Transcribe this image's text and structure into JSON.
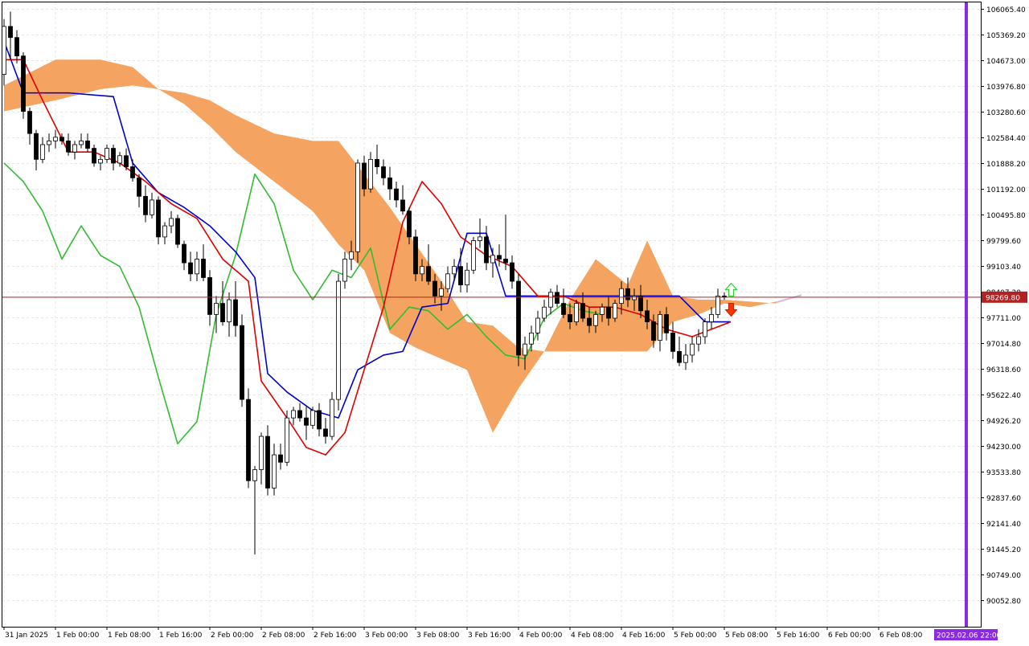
{
  "chart_data": {
    "type": "candlestick",
    "symbol_hint": "",
    "y_axis": {
      "ticks": [
        106065.4,
        105369.2,
        104673.0,
        103976.8,
        103280.6,
        102584.4,
        101888.2,
        101192.0,
        100495.8,
        99799.6,
        99103.4,
        98407.2,
        97711.0,
        97014.8,
        96318.6,
        95622.4,
        94926.2,
        94230.0,
        93533.8,
        92837.6,
        92141.4,
        91445.2,
        90749.0,
        90052.8
      ],
      "tick_labels": [
        "106065.40",
        "105369.20",
        "104673.00",
        "103976.80",
        "103280.60",
        "102584.40",
        "101888.20",
        "101192.00",
        "100495.80",
        "99799.60",
        "99103.40",
        "98407.20",
        "97711.00",
        "97014.80",
        "96318.60",
        "95622.40",
        "94926.20",
        "94230.00",
        "93533.80",
        "92837.60",
        "92141.40",
        "91445.20",
        "90749.00",
        "90052.80"
      ],
      "range": [
        89500,
        106300
      ]
    },
    "x_axis": {
      "tick_labels": [
        "31 Jan 2025",
        "1 Feb 00:00",
        "1 Feb 08:00",
        "1 Feb 16:00",
        "2 Feb 00:00",
        "2 Feb 08:00",
        "2 Feb 16:00",
        "3 Feb 00:00",
        "3 Feb 08:00",
        "3 Feb 16:00",
        "4 Feb 00:00",
        "4 Feb 08:00",
        "4 Feb 16:00",
        "5 Feb 00:00",
        "5 Feb 08:00",
        "5 Feb 16:00",
        "6 Feb 00:00",
        "6 Feb 08:00"
      ],
      "bars_per_tick": 8,
      "total_slots": 185
    },
    "current_price": {
      "value": 98269.8,
      "label": "98269.80"
    },
    "cursor_time_label": "2025.02.06 22:00",
    "grid": true,
    "colors": {
      "up_candle_border": "#000000",
      "down_candle_fill": "#000000",
      "tenkan": "#dd0000",
      "kijun": "#0000cc",
      "chikou": "#33bb33",
      "kumo_bull": "#f4a460",
      "kumo_bear": "#d8bfd8",
      "price_line": "#b22222",
      "vertical_marker": "#8a2be2",
      "arrow_up": "#33cc33",
      "arrow_down": "#ff3300"
    },
    "candles": [
      [
        104300,
        105800,
        104000,
        105600
      ],
      [
        105600,
        106000,
        104700,
        105300
      ],
      [
        105300,
        105500,
        104600,
        104800
      ],
      [
        104800,
        104900,
        103100,
        103300
      ],
      [
        103300,
        103400,
        102400,
        102700
      ],
      [
        102700,
        102800,
        101700,
        102000
      ],
      [
        102000,
        102600,
        101900,
        102400
      ],
      [
        102400,
        102700,
        102200,
        102500
      ],
      [
        102500,
        102800,
        102300,
        102600
      ],
      [
        102600,
        102700,
        102400,
        102500
      ],
      [
        102500,
        102700,
        102100,
        102200
      ],
      [
        102200,
        102500,
        102000,
        102400
      ],
      [
        102400,
        102700,
        102300,
        102500
      ],
      [
        102500,
        102700,
        102200,
        102300
      ],
      [
        102300,
        102400,
        101800,
        101900
      ],
      [
        101900,
        102100,
        101700,
        102000
      ],
      [
        102000,
        102400,
        101900,
        102300
      ],
      [
        102300,
        102400,
        101700,
        101900
      ],
      [
        101900,
        102200,
        101800,
        102100
      ],
      [
        102100,
        102300,
        101700,
        101800
      ],
      [
        101800,
        102000,
        101400,
        101500
      ],
      [
        101500,
        101600,
        100700,
        101000
      ],
      [
        101000,
        101300,
        100300,
        100500
      ],
      [
        100500,
        101100,
        100400,
        100900
      ],
      [
        100900,
        101000,
        99700,
        99900
      ],
      [
        99900,
        100300,
        99700,
        100200
      ],
      [
        100200,
        100600,
        100000,
        100400
      ],
      [
        100400,
        100500,
        99600,
        99700
      ],
      [
        99700,
        99800,
        99000,
        99200
      ],
      [
        99200,
        99500,
        98700,
        98900
      ],
      [
        98900,
        99500,
        98700,
        99300
      ],
      [
        99300,
        99700,
        98700,
        98800
      ],
      [
        98800,
        99000,
        97500,
        97800
      ],
      [
        97800,
        98300,
        97300,
        98100
      ],
      [
        98100,
        98700,
        97500,
        97600
      ],
      [
        97600,
        98400,
        97200,
        98200
      ],
      [
        98200,
        98700,
        97200,
        97500
      ],
      [
        97500,
        97800,
        95300,
        95500
      ],
      [
        95500,
        95800,
        93100,
        93300
      ],
      [
        93300,
        93700,
        91300,
        93600
      ],
      [
        93600,
        94600,
        93200,
        94500
      ],
      [
        94500,
        94800,
        92900,
        93100
      ],
      [
        93100,
        94300,
        92900,
        94000
      ],
      [
        94000,
        94300,
        93600,
        93800
      ],
      [
        93800,
        95200,
        93700,
        95000
      ],
      [
        95000,
        95300,
        94800,
        95200
      ],
      [
        95200,
        95400,
        94900,
        95000
      ],
      [
        95000,
        95300,
        94400,
        94800
      ],
      [
        94800,
        95300,
        94700,
        95200
      ],
      [
        95200,
        95400,
        94500,
        94700
      ],
      [
        94700,
        95000,
        94300,
        94500
      ],
      [
        94500,
        95700,
        94400,
        95500
      ],
      [
        95500,
        98900,
        95200,
        98700
      ],
      [
        98700,
        99500,
        98500,
        99300
      ],
      [
        99300,
        99800,
        99000,
        99500
      ],
      [
        99500,
        102000,
        99200,
        101900
      ],
      [
        101900,
        102100,
        101000,
        101200
      ],
      [
        101200,
        102200,
        101100,
        102000
      ],
      [
        102000,
        102400,
        101600,
        101800
      ],
      [
        101800,
        102000,
        101300,
        101500
      ],
      [
        101500,
        101800,
        100900,
        101200
      ],
      [
        101200,
        101400,
        100700,
        100900
      ],
      [
        100900,
        101300,
        100500,
        100600
      ],
      [
        100600,
        100700,
        99700,
        99900
      ],
      [
        99900,
        100100,
        98700,
        98900
      ],
      [
        98900,
        99300,
        98700,
        99100
      ],
      [
        99100,
        99700,
        98600,
        98700
      ],
      [
        98700,
        98900,
        98100,
        98300
      ],
      [
        98300,
        98700,
        97900,
        98500
      ],
      [
        98500,
        99100,
        98400,
        98900
      ],
      [
        98900,
        99300,
        98700,
        99100
      ],
      [
        99100,
        99600,
        98400,
        98600
      ],
      [
        98600,
        99200,
        98400,
        99000
      ],
      [
        99000,
        99900,
        98900,
        99800
      ],
      [
        99800,
        100400,
        99600,
        99900
      ],
      [
        99900,
        100200,
        99000,
        99200
      ],
      [
        99200,
        99600,
        98800,
        99400
      ],
      [
        99400,
        99700,
        99100,
        99300
      ],
      [
        99300,
        100500,
        99000,
        99200
      ],
      [
        99200,
        99400,
        98500,
        98700
      ],
      [
        98700,
        98900,
        96400,
        96700
      ],
      [
        96700,
        97200,
        96300,
        97000
      ],
      [
        97000,
        97500,
        96800,
        97300
      ],
      [
        97300,
        97900,
        97100,
        97700
      ],
      [
        97700,
        98200,
        97600,
        98000
      ],
      [
        98000,
        98500,
        97800,
        98400
      ],
      [
        98400,
        98600,
        98000,
        98100
      ],
      [
        98100,
        98500,
        97700,
        97800
      ],
      [
        97800,
        98100,
        97400,
        97600
      ],
      [
        97600,
        98200,
        97500,
        98100
      ],
      [
        98100,
        98400,
        97600,
        97700
      ],
      [
        97700,
        98000,
        97300,
        97500
      ],
      [
        97500,
        97900,
        97300,
        97800
      ],
      [
        97800,
        98100,
        97600,
        98000
      ],
      [
        98000,
        98300,
        97500,
        97700
      ],
      [
        97700,
        98200,
        97600,
        98100
      ],
      [
        98100,
        98700,
        97800,
        98500
      ],
      [
        98500,
        98800,
        98000,
        98200
      ],
      [
        98200,
        98500,
        97900,
        98300
      ],
      [
        98300,
        98600,
        97700,
        97900
      ],
      [
        97900,
        98200,
        97400,
        97600
      ],
      [
        97600,
        97800,
        96900,
        97100
      ],
      [
        97100,
        97900,
        96800,
        97800
      ],
      [
        97800,
        98000,
        97100,
        97300
      ],
      [
        97300,
        97600,
        96600,
        96800
      ],
      [
        96800,
        97200,
        96400,
        96500
      ],
      [
        96500,
        97000,
        96300,
        96700
      ],
      [
        96700,
        97200,
        96500,
        97000
      ],
      [
        97000,
        97400,
        96800,
        97200
      ],
      [
        97200,
        97700,
        97000,
        97600
      ],
      [
        97600,
        98000,
        97400,
        97800
      ],
      [
        97800,
        98500,
        97700,
        98300
      ],
      [
        98300,
        98400,
        98200,
        98270
      ]
    ],
    "candle_slots": [
      0,
      1,
      2,
      3,
      4,
      5,
      6,
      7,
      8,
      9,
      10,
      11,
      12,
      13,
      14,
      15,
      16,
      17,
      18,
      19,
      20,
      21,
      22,
      23,
      24,
      25,
      26,
      27,
      28,
      29,
      30,
      31,
      32,
      33,
      34,
      35,
      36,
      37,
      38,
      39,
      40,
      41,
      42,
      43,
      44,
      45,
      46,
      47,
      48,
      49,
      50,
      51,
      52,
      53,
      54,
      55,
      56,
      57,
      58,
      59,
      60,
      61,
      62,
      63,
      64,
      65,
      66,
      67,
      68,
      69,
      70,
      71,
      72,
      73,
      74,
      75,
      76,
      77,
      78,
      79,
      80,
      81,
      82,
      83,
      84,
      85,
      86,
      87,
      88,
      89,
      90,
      91,
      92,
      93,
      94,
      95,
      96,
      97,
      98,
      99,
      100,
      101,
      102,
      103,
      104,
      105,
      106,
      107,
      108,
      109,
      110,
      111,
      112,
      113
    ],
    "tenkan": [
      [
        0,
        104700
      ],
      [
        3,
        104700
      ],
      [
        6,
        103600
      ],
      [
        10,
        102200
      ],
      [
        14,
        102200
      ],
      [
        18,
        101900
      ],
      [
        22,
        101400
      ],
      [
        26,
        100800
      ],
      [
        30,
        100400
      ],
      [
        34,
        99300
      ],
      [
        38,
        98700
      ],
      [
        40,
        96000
      ],
      [
        44,
        95000
      ],
      [
        47,
        94200
      ],
      [
        50,
        94000
      ],
      [
        53,
        94600
      ],
      [
        56,
        96300
      ],
      [
        59,
        98000
      ],
      [
        62,
        100300
      ],
      [
        65,
        101400
      ],
      [
        68,
        100800
      ],
      [
        71,
        99900
      ],
      [
        75,
        99400
      ],
      [
        79,
        99100
      ],
      [
        83,
        98300
      ],
      [
        87,
        98300
      ],
      [
        91,
        98000
      ],
      [
        95,
        98000
      ],
      [
        99,
        97800
      ],
      [
        103,
        97400
      ],
      [
        107,
        97200
      ],
      [
        110,
        97400
      ],
      [
        113,
        97600
      ]
    ],
    "kijun": [
      [
        0,
        105200
      ],
      [
        3,
        103800
      ],
      [
        10,
        103800
      ],
      [
        17,
        103700
      ],
      [
        20,
        101900
      ],
      [
        24,
        101100
      ],
      [
        28,
        100700
      ],
      [
        32,
        100200
      ],
      [
        36,
        99500
      ],
      [
        39,
        98800
      ],
      [
        41,
        96200
      ],
      [
        44,
        95700
      ],
      [
        48,
        95200
      ],
      [
        52,
        95000
      ],
      [
        55,
        96300
      ],
      [
        59,
        96700
      ],
      [
        62,
        96800
      ],
      [
        65,
        98000
      ],
      [
        69,
        98100
      ],
      [
        72,
        100000
      ],
      [
        75,
        100000
      ],
      [
        78,
        98300
      ],
      [
        82,
        98300
      ],
      [
        85,
        98300
      ],
      [
        89,
        98300
      ],
      [
        93,
        98300
      ],
      [
        97,
        98300
      ],
      [
        101,
        98300
      ],
      [
        105,
        98300
      ],
      [
        109,
        97600
      ],
      [
        113,
        97600
      ]
    ],
    "chikou": [
      [
        0,
        101900
      ],
      [
        3,
        101400
      ],
      [
        6,
        100600
      ],
      [
        9,
        99300
      ],
      [
        12,
        100200
      ],
      [
        15,
        99400
      ],
      [
        18,
        99100
      ],
      [
        21,
        98000
      ],
      [
        24,
        96100
      ],
      [
        27,
        94300
      ],
      [
        30,
        94900
      ],
      [
        33,
        97800
      ],
      [
        36,
        99400
      ],
      [
        39,
        101600
      ],
      [
        42,
        100800
      ],
      [
        45,
        99000
      ],
      [
        48,
        98200
      ],
      [
        51,
        99000
      ],
      [
        54,
        98800
      ],
      [
        57,
        99600
      ],
      [
        60,
        97400
      ],
      [
        63,
        98000
      ],
      [
        66,
        97900
      ],
      [
        69,
        97400
      ],
      [
        72,
        97800
      ],
      [
        75,
        97200
      ],
      [
        78,
        96700
      ],
      [
        81,
        96600
      ],
      [
        84,
        97700
      ],
      [
        87,
        98100
      ],
      [
        90,
        97900
      ],
      [
        93,
        97800
      ]
    ],
    "kumo": {
      "span_a": [
        [
          0,
          104000
        ],
        [
          8,
          104700
        ],
        [
          15,
          104700
        ],
        [
          20,
          104500
        ],
        [
          24,
          103900
        ],
        [
          28,
          103800
        ],
        [
          32,
          103600
        ],
        [
          36,
          103200
        ],
        [
          42,
          102700
        ],
        [
          48,
          102500
        ],
        [
          52,
          102500
        ],
        [
          56,
          101600
        ],
        [
          60,
          100700
        ],
        [
          64,
          99700
        ],
        [
          68,
          98700
        ],
        [
          72,
          97600
        ],
        [
          76,
          97500
        ],
        [
          80,
          96900
        ],
        [
          84,
          96800
        ],
        [
          88,
          98200
        ],
        [
          92,
          99300
        ],
        [
          97,
          98600
        ],
        [
          100,
          99800
        ],
        [
          104,
          98300
        ],
        [
          108,
          98200
        ],
        [
          112,
          98200
        ],
        [
          116,
          98150
        ],
        [
          120,
          98100
        ],
        [
          124,
          98300
        ]
      ],
      "span_b": [
        [
          0,
          103300
        ],
        [
          8,
          103600
        ],
        [
          15,
          103900
        ],
        [
          20,
          104000
        ],
        [
          24,
          103900
        ],
        [
          28,
          103500
        ],
        [
          32,
          102900
        ],
        [
          36,
          102200
        ],
        [
          42,
          101400
        ],
        [
          48,
          100600
        ],
        [
          52,
          99700
        ],
        [
          56,
          99000
        ],
        [
          60,
          97300
        ],
        [
          64,
          96900
        ],
        [
          68,
          96600
        ],
        [
          72,
          96300
        ],
        [
          76,
          94600
        ],
        [
          80,
          95800
        ],
        [
          84,
          96800
        ],
        [
          88,
          96800
        ],
        [
          92,
          96800
        ],
        [
          97,
          96800
        ],
        [
          100,
          96800
        ],
        [
          104,
          97600
        ],
        [
          108,
          97800
        ],
        [
          112,
          98100
        ],
        [
          116,
          98000
        ],
        [
          120,
          98150
        ],
        [
          124,
          98350
        ]
      ],
      "bull_threshold_note": ""
    },
    "arrows": [
      {
        "dir": "up",
        "slot": 113,
        "price": 98450
      },
      {
        "dir": "down",
        "slot": 113,
        "price": 97950
      }
    ]
  }
}
